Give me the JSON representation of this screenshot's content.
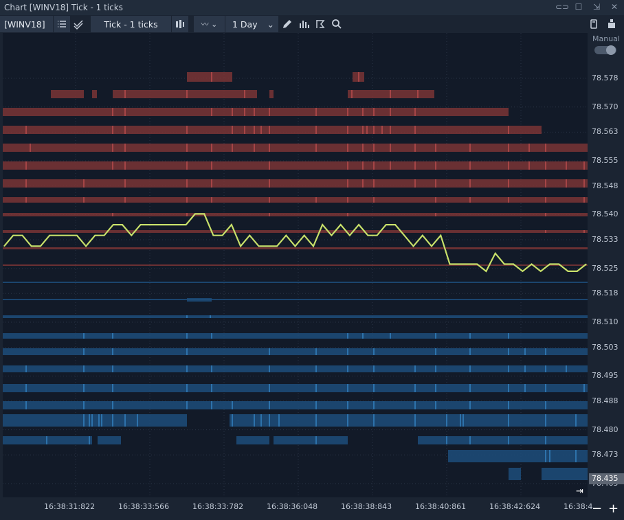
{
  "window": {
    "title": "Chart [WINV18] Tick - 1 ticks"
  },
  "toolbar": {
    "symbol": "[WINV18]",
    "interval": "Tick - 1 ticks",
    "range": "1 Day"
  },
  "price_axis": {
    "mode_label": "Manual",
    "last_price": "78.435",
    "labels": [
      "78.578",
      "78.570",
      "78.563",
      "78.555",
      "78.548",
      "78.540",
      "78.533",
      "78.525",
      "78.518",
      "78.510",
      "78.503",
      "78.495",
      "78.488",
      "78.480",
      "78.473",
      "78.465"
    ]
  },
  "time_axis": {
    "labels": [
      "16:38:31:822",
      "16:38:33:566",
      "16:38:33:782",
      "16:38:36:048",
      "16:38:38:843",
      "16:38:40:861",
      "16:38:42:624",
      "16:38:4"
    ]
  },
  "colors": {
    "ask_band": "#7a3535",
    "ask_line": "#e05a5a",
    "bid_band": "#1d4e7a",
    "bid_line": "#3f9ee8",
    "price_line": "#c8e06a",
    "background": "#121a28"
  },
  "chart_data": {
    "type": "line",
    "series": [
      {
        "values": [
          78.522,
          78.525,
          78.525,
          78.522,
          78.522,
          78.525,
          78.525,
          78.525,
          78.525,
          78.522,
          78.525,
          78.525,
          78.528,
          78.528,
          78.525,
          78.528,
          78.528,
          78.528,
          78.528,
          78.528,
          78.528,
          78.531,
          78.531,
          78.525,
          78.525,
          78.528,
          78.522,
          78.525,
          78.522,
          78.522,
          78.522,
          78.525,
          78.522,
          78.525,
          78.522,
          78.528,
          78.525,
          78.528,
          78.525,
          78.528,
          78.525,
          78.525,
          78.528,
          78.528,
          78.525,
          78.522,
          78.525,
          78.522,
          78.525,
          78.517,
          78.517,
          78.517,
          78.517,
          78.515,
          78.52,
          78.517,
          78.517,
          78.515,
          78.517,
          78.515,
          78.517,
          78.517,
          78.515,
          78.515,
          78.517
        ],
        "color": "#c8e06a"
      }
    ],
    "ylim": [
      78.463,
      78.583
    ],
    "y_ticks": [
      78.578,
      78.57,
      78.563,
      78.555,
      78.548,
      78.54,
      78.533,
      78.525,
      78.518,
      78.51,
      78.503,
      78.495,
      78.488,
      78.48,
      78.473,
      78.465
    ],
    "grid": true,
    "legend": "none"
  }
}
